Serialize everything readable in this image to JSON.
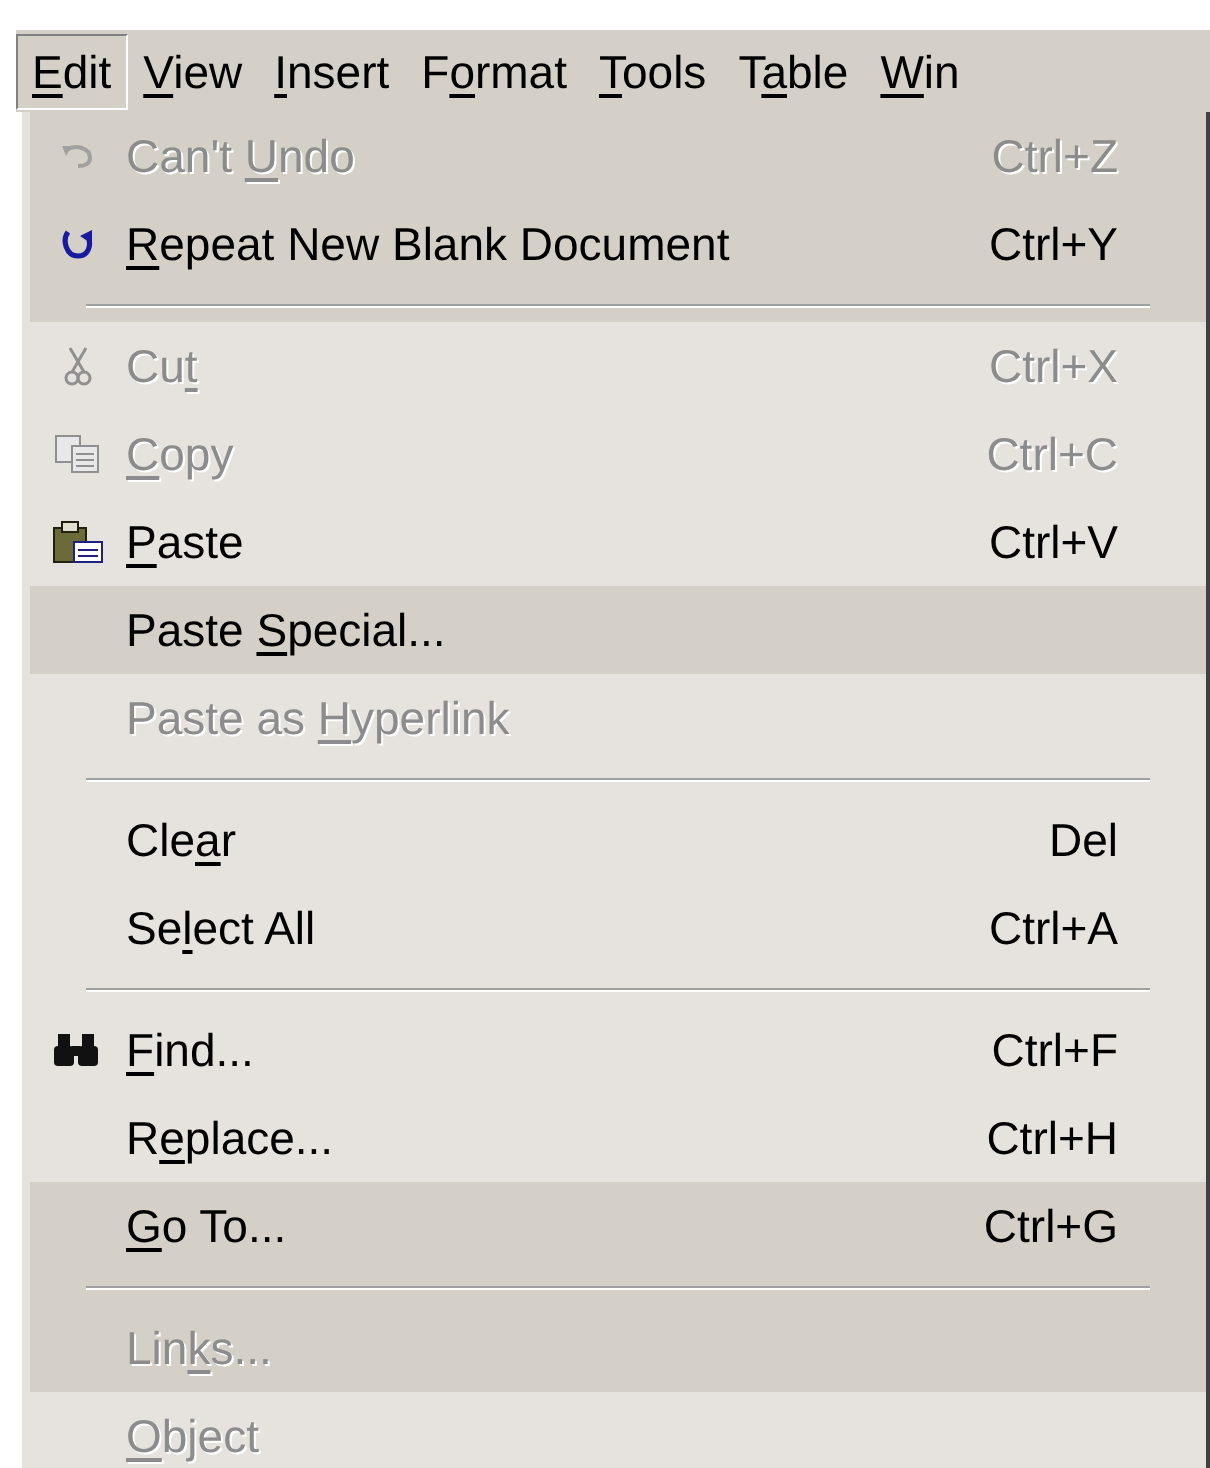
{
  "menu_bar": [
    {
      "key": "E",
      "post": "dit",
      "selected": true
    },
    {
      "key": "V",
      "post": "iew",
      "selected": false
    },
    {
      "key": "I",
      "post": "nsert",
      "selected": false
    },
    {
      "pre": "F",
      "key": "o",
      "post": "rmat",
      "selected": false
    },
    {
      "key": "T",
      "post": "ools",
      "selected": false
    },
    {
      "pre": "T",
      "key": "a",
      "post": "ble",
      "selected": false
    },
    {
      "key": "W",
      "post": "in",
      "selected": false
    }
  ],
  "edit_menu": [
    {
      "kind": "item",
      "pre": "Can't ",
      "key": "U",
      "post": "ndo",
      "shortcut": "Ctrl+Z",
      "disabled": true,
      "rarely_used": true
    },
    {
      "kind": "item",
      "key": "R",
      "post": "epeat New Blank Document",
      "shortcut": "Ctrl+Y",
      "disabled": false,
      "rarely_used": true
    },
    {
      "kind": "separator"
    },
    {
      "kind": "item",
      "pre": "Cu",
      "key": "t",
      "shortcut": "Ctrl+X",
      "disabled": true,
      "rarely_used": false
    },
    {
      "kind": "item",
      "key": "C",
      "post": "opy",
      "shortcut": "Ctrl+C",
      "disabled": true,
      "rarely_used": false
    },
    {
      "kind": "item",
      "key": "P",
      "post": "aste",
      "shortcut": "Ctrl+V",
      "disabled": false,
      "rarely_used": false
    },
    {
      "kind": "item",
      "pre": "Paste ",
      "key": "S",
      "post": "pecial...",
      "disabled": false,
      "rarely_used": true
    },
    {
      "kind": "item",
      "pre": "Paste as ",
      "key": "H",
      "post": "yperlink",
      "disabled": true,
      "rarely_used": false
    },
    {
      "kind": "separator"
    },
    {
      "kind": "item",
      "pre": "Cle",
      "key": "a",
      "post": "r",
      "shortcut": "Del",
      "disabled": false,
      "rarely_used": false
    },
    {
      "kind": "item",
      "pre": "Se",
      "key": "l",
      "post": "ect All",
      "shortcut": "Ctrl+A",
      "disabled": false,
      "rarely_used": false
    },
    {
      "kind": "separator"
    },
    {
      "kind": "item",
      "key": "F",
      "post": "ind...",
      "shortcut": "Ctrl+F",
      "disabled": false,
      "rarely_used": false
    },
    {
      "kind": "item",
      "pre": "R",
      "key": "e",
      "post": "place...",
      "shortcut": "Ctrl+H",
      "disabled": false,
      "rarely_used": false
    },
    {
      "kind": "item",
      "key": "G",
      "post": "o To...",
      "shortcut": "Ctrl+G",
      "disabled": false,
      "rarely_used": true
    },
    {
      "kind": "separator"
    },
    {
      "kind": "item",
      "pre": "Lin",
      "key": "k",
      "post": "s...",
      "disabled": true,
      "rarely_used": true
    },
    {
      "kind": "item",
      "key": "O",
      "post": "bject",
      "disabled": true,
      "rarely_used": false
    }
  ]
}
